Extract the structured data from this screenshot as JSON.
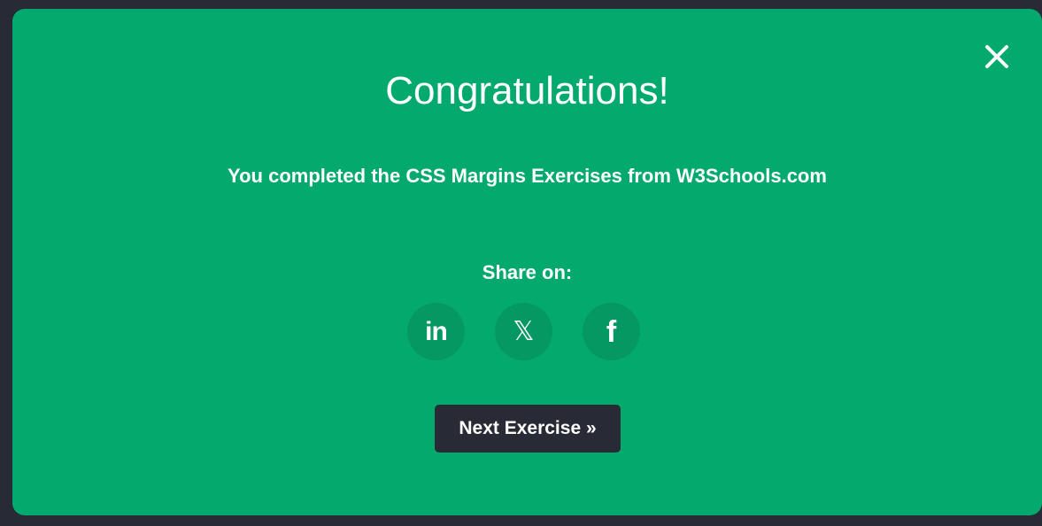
{
  "modal": {
    "title": "Congratulations!",
    "message": "You completed the CSS Margins Exercises from W3Schools.com",
    "share_label": "Share on:",
    "share_buttons": [
      {
        "icon": "linkedin-icon",
        "glyph": "in"
      },
      {
        "icon": "x-icon",
        "glyph": "𝕏"
      },
      {
        "icon": "facebook-icon",
        "glyph": "f"
      }
    ],
    "next_button_label": "Next Exercise »",
    "close_icon": "close-icon"
  },
  "colors": {
    "modal_background": "#04aa6d",
    "share_button_background": "#059862",
    "page_background": "#282a35",
    "next_button_background": "#282a35",
    "text": "#ffffff"
  }
}
